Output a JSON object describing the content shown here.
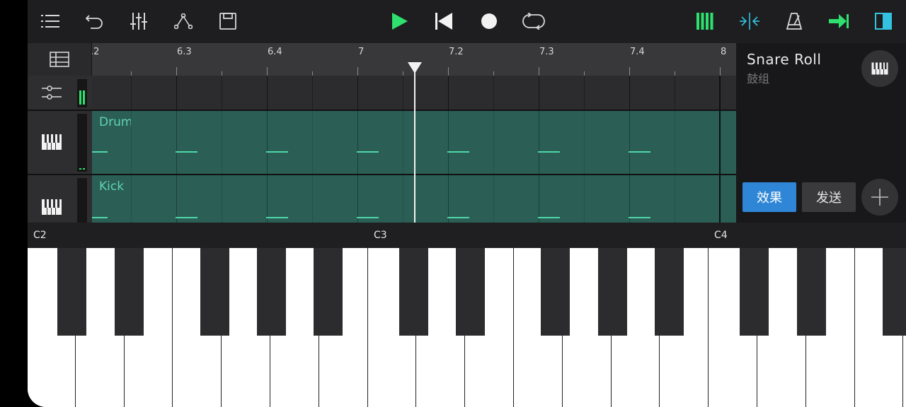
{
  "colors": {
    "accent_green": "#2ee06e",
    "teal": "#33d3c8",
    "clip_bg": "#2b5e55",
    "note_color": "#4fd6a8",
    "fx_blue": "#2f86d6"
  },
  "toolbar": {
    "left_icons": [
      "menu-icon",
      "undo-icon",
      "mixer-sliders-icon",
      "automation-nodes-icon",
      "save-icon"
    ],
    "transport_icons": [
      "play-icon",
      "skip-to-start-icon",
      "record-icon",
      "loop-icon"
    ],
    "right_icons": [
      "piano-keys-icon",
      "split-arrows-icon",
      "metronome-icon",
      "arrow-right-icon",
      "side-panel-icon"
    ]
  },
  "ruler": {
    "labels": [
      ".2",
      "6.3",
      "6.4",
      "7",
      "7.2",
      "7.3",
      "7.4",
      "8"
    ]
  },
  "tracks": [
    {
      "name": "Drum"
    },
    {
      "name": "Kick"
    }
  ],
  "panel": {
    "instrument_name": "Snare Roll",
    "instrument_group": "鼓组",
    "effects_label": "效果",
    "send_label": "发送"
  },
  "keyboard": {
    "octave_labels": [
      "C2",
      "C3",
      "C4"
    ]
  }
}
